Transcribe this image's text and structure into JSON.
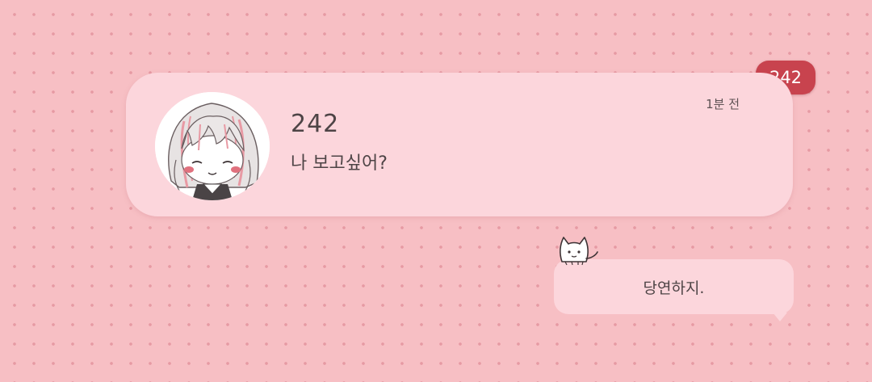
{
  "notification": {
    "sender": "242",
    "message": "나 보고싶어?",
    "time": "1분 전",
    "avatar_icon": "chibi-girl-avatar-icon"
  },
  "badge": {
    "text": "242",
    "color": "#c8434e"
  },
  "reply": {
    "text": "당연하지.",
    "decoration_icon": "cat-icon"
  },
  "colors": {
    "background": "#f7bfc4",
    "dots": "#e69aa3",
    "card": "#fcd6dc",
    "text": "#4e4446"
  }
}
